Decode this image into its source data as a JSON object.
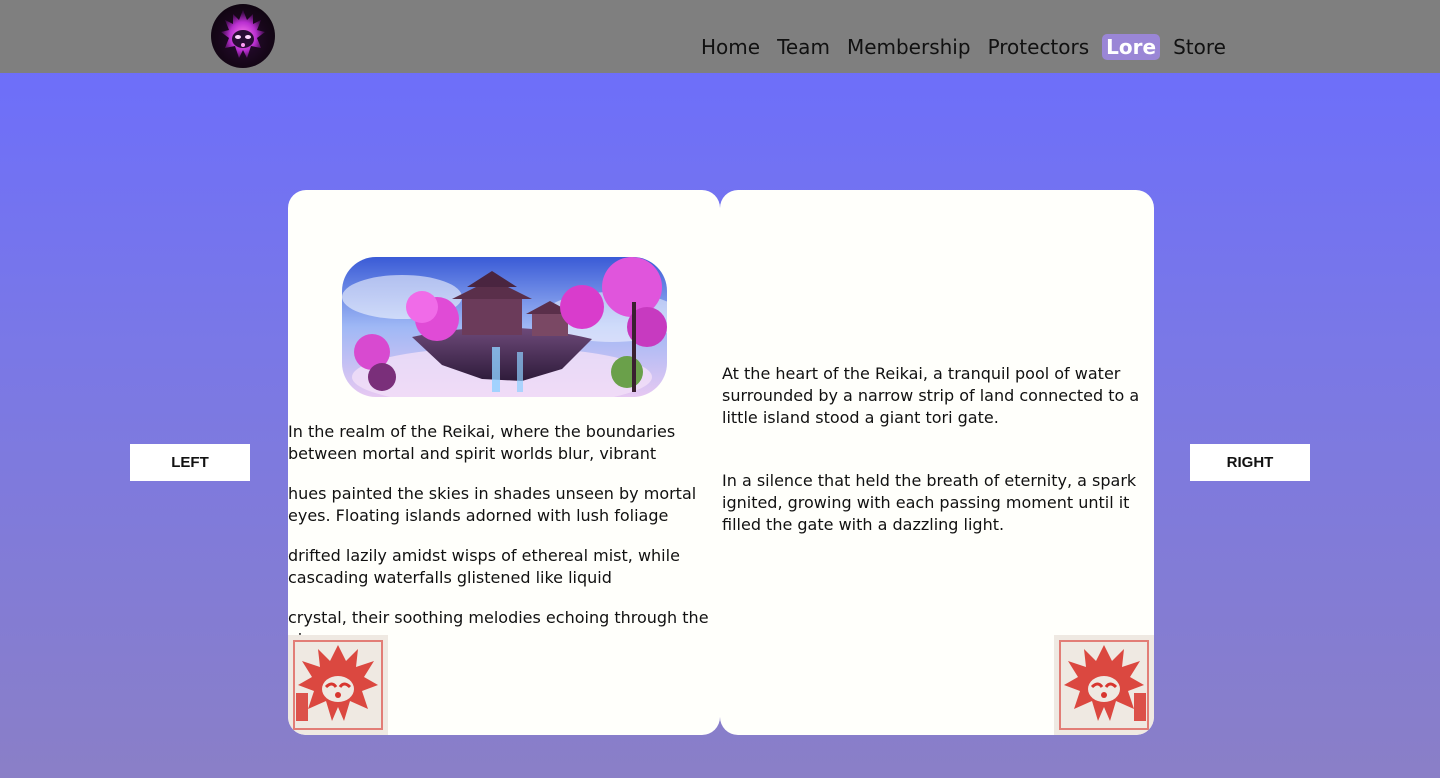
{
  "nav": {
    "items": [
      {
        "label": "Home",
        "active": false
      },
      {
        "label": "Team",
        "active": false
      },
      {
        "label": "Membership",
        "active": false
      },
      {
        "label": "Protectors",
        "active": false
      },
      {
        "label": "Lore",
        "active": true
      },
      {
        "label": "Store",
        "active": false
      }
    ]
  },
  "buttons": {
    "left_label": "LEFT",
    "right_label": "RIGHT"
  },
  "book": {
    "left_page": {
      "paragraphs": [
        "In the realm of the Reikai, where the boundaries between mortal and spirit worlds blur, vibrant",
        "hues painted the skies in shades unseen by mortal eyes. Floating islands adorned with lush foliage",
        "drifted lazily amidst wisps of ethereal mist, while cascading waterfalls glistened like liquid",
        "crystal, their soothing melodies echoing through the air."
      ]
    },
    "right_page": {
      "paragraphs": [
        "At the heart of the Reikai, a tranquil pool of water surrounded by a narrow strip of land connected to a little island stood a giant tori gate.",
        "In a silence that held the breath of eternity, a spark ignited, growing with each passing moment until it filled the gate with a dazzling light."
      ]
    }
  },
  "icons": {
    "logo": "flame-spirit-logo-icon",
    "illustration": "floating-island-illustration",
    "stamp": "red-spirit-mask-stamp-icon"
  },
  "colors": {
    "nav_bg": "#7f7f7f",
    "active_nav_bg": "#9a86d6",
    "background_top": "#6a6cff",
    "background_bottom": "#8a7fc7",
    "page_bg": "#fffffb",
    "stamp_red": "#d8362f"
  }
}
